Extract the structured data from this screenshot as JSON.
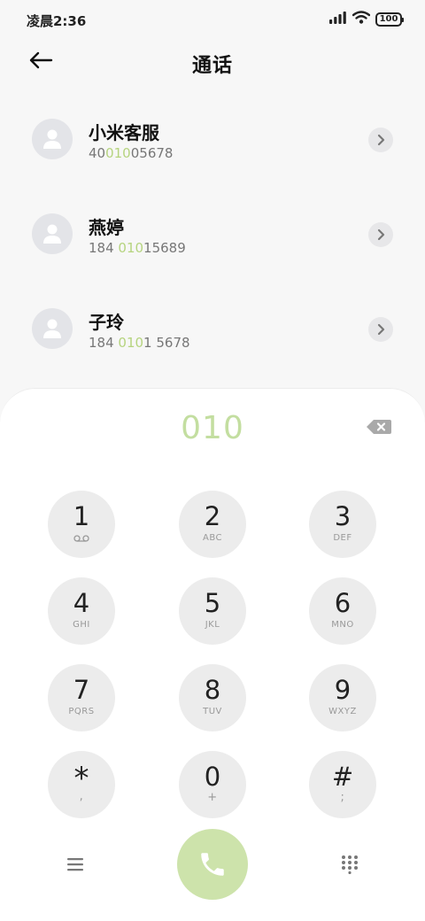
{
  "status_bar": {
    "time": "凌晨2:36",
    "battery": "100",
    "icons": [
      "signal-icon",
      "wifi-icon",
      "battery-icon"
    ]
  },
  "header": {
    "title": "通话",
    "back_icon": "arrow-left-icon"
  },
  "contacts": [
    {
      "name": "小米客服",
      "number_parts": [
        "40",
        "010",
        "05678"
      ]
    },
    {
      "name": "燕婷",
      "number_parts": [
        "184 ",
        "010",
        "15689"
      ]
    },
    {
      "name": "子玲",
      "number_parts": [
        "184 ",
        "010",
        "1 5678"
      ]
    }
  ],
  "dialer": {
    "input": "010",
    "delete_icon": "backspace-icon",
    "keys": [
      {
        "digit": "1",
        "letters": ""
      },
      {
        "digit": "2",
        "letters": "ABC"
      },
      {
        "digit": "3",
        "letters": "DEF"
      },
      {
        "digit": "4",
        "letters": "GHI"
      },
      {
        "digit": "5",
        "letters": "JKL"
      },
      {
        "digit": "6",
        "letters": "MNO"
      },
      {
        "digit": "7",
        "letters": "PQRS"
      },
      {
        "digit": "8",
        "letters": "TUV"
      },
      {
        "digit": "9",
        "letters": "WXYZ"
      },
      {
        "digit": "*",
        "letters": ","
      },
      {
        "digit": "0",
        "letters": "+"
      },
      {
        "digit": "#",
        "letters": ";"
      }
    ]
  },
  "bottom_bar": {
    "left_icon": "menu-icon",
    "center_icon": "phone-icon",
    "right_icon": "dialpad-icon"
  },
  "colors": {
    "accent": "#c3dea0",
    "call_button": "#cde3ab",
    "highlight": "#b6d47f",
    "key_bg": "#ececec"
  }
}
